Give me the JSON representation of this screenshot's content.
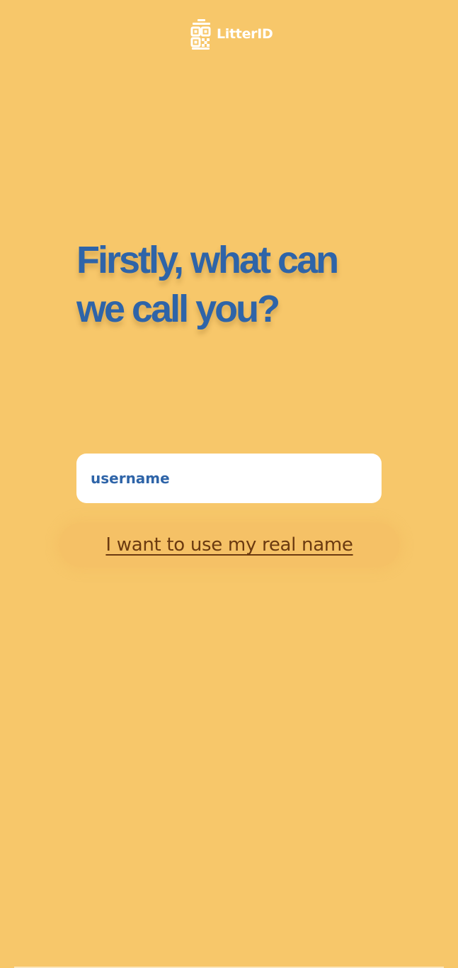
{
  "brand": {
    "name": "LitterID",
    "logo_icon": "qr-bin-icon",
    "color": "#ffffff"
  },
  "headline": {
    "text": "Firstly, what can we call you?"
  },
  "form": {
    "username_placeholder": "username",
    "username_value": ""
  },
  "actions": {
    "real_name_label": "I want to use my real name"
  },
  "colors": {
    "background": "#f7c76a",
    "accent": "#2e64a8",
    "link": "#6b3a10",
    "input_background": "#ffffff"
  }
}
